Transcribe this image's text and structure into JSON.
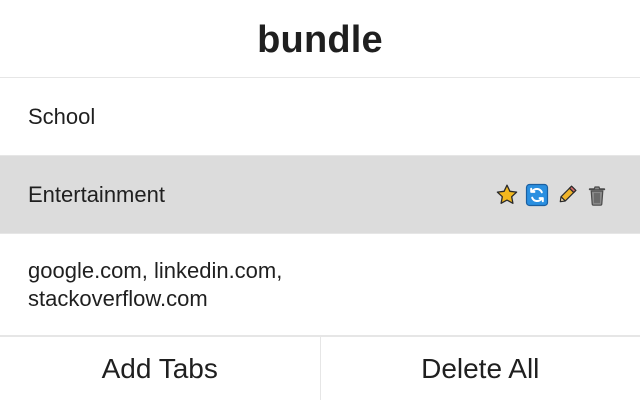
{
  "header": {
    "title": "bundle"
  },
  "bundles": [
    {
      "label": "School",
      "selected": false
    },
    {
      "label": "Entertainment",
      "selected": true,
      "actions": [
        {
          "name": "favorite",
          "icon": "star-icon"
        },
        {
          "name": "sync",
          "icon": "refresh-icon"
        },
        {
          "name": "edit",
          "icon": "pencil-icon"
        },
        {
          "name": "delete",
          "icon": "trash-icon"
        }
      ]
    }
  ],
  "details": {
    "urls_text": "google.com, linkedin.com, stackoverflow.com"
  },
  "footer": {
    "add_tabs_label": "Add Tabs",
    "delete_all_label": "Delete All"
  },
  "colors": {
    "selected_row_bg": "#dcdcdc",
    "divider": "#e6e6e6",
    "star": "#f2b81e",
    "refresh_bg": "#2a8fe0",
    "pencil": "#f0b429",
    "trash": "#8a8a8a"
  }
}
